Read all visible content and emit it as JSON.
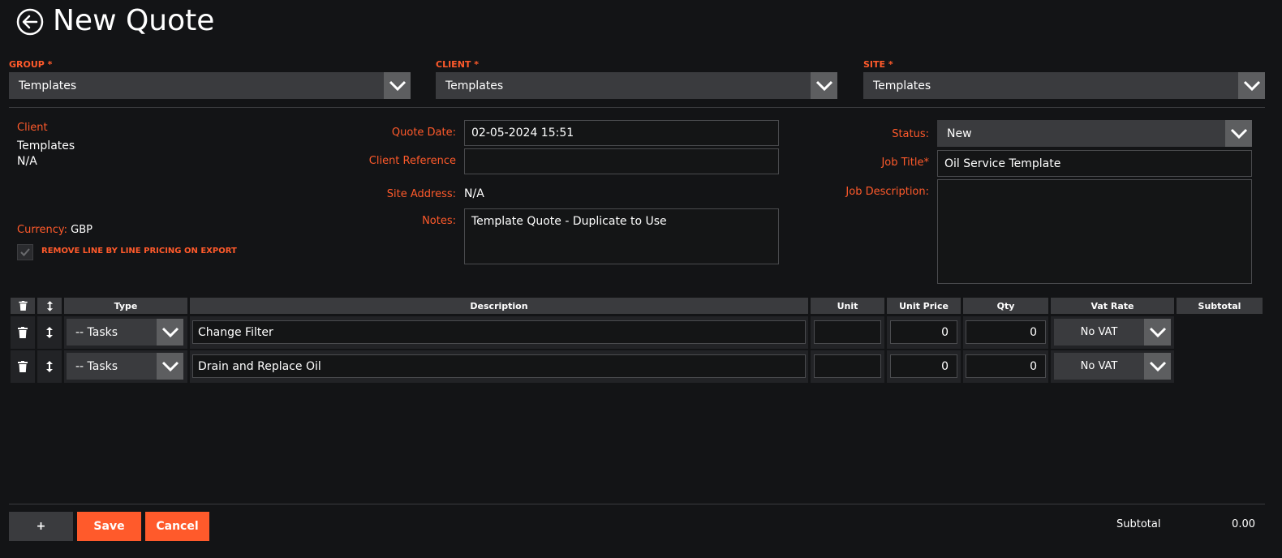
{
  "header": {
    "title": "New Quote"
  },
  "top": {
    "group": {
      "label": "GROUP *",
      "value": "Templates"
    },
    "client": {
      "label": "CLIENT *",
      "value": "Templates"
    },
    "site": {
      "label": "SITE *",
      "value": "Templates"
    }
  },
  "left": {
    "client_label": "Client",
    "client_name": "Templates",
    "client_ref": "N/A",
    "currency_label": "Currency:",
    "currency_value": "GBP",
    "remove_pricing_label": "REMOVE LINE BY LINE PRICING ON EXPORT"
  },
  "middle": {
    "quote_date_label": "Quote Date:",
    "quote_date_value": "02-05-2024 15:51",
    "client_reference_label": "Client Reference",
    "client_reference_value": "",
    "site_address_label": "Site Address:",
    "site_address_value": "N/A",
    "notes_label": "Notes:",
    "notes_value": "Template Quote - Duplicate to Use"
  },
  "right": {
    "status_label": "Status:",
    "status_value": "New",
    "job_title_label": "Job Title*",
    "job_title_value": "Oil Service Template",
    "job_description_label": "Job Description:",
    "job_description_value": ""
  },
  "table": {
    "headers": {
      "type": "Type",
      "description": "Description",
      "unit": "Unit",
      "unit_price": "Unit Price",
      "qty": "Qty",
      "vat_rate": "Vat Rate",
      "subtotal": "Subtotal"
    },
    "rows": [
      {
        "type": "-- Tasks",
        "description": "Change Filter",
        "unit": "",
        "unit_price": "0",
        "qty": "0",
        "vat": "No VAT"
      },
      {
        "type": "-- Tasks",
        "description": "Drain and Replace Oil",
        "unit": "",
        "unit_price": "0",
        "qty": "0",
        "vat": "No VAT"
      }
    ]
  },
  "footer": {
    "add_label": "+",
    "save_label": "Save",
    "cancel_label": "Cancel",
    "subtotal_label": "Subtotal",
    "subtotal_value": "0.00"
  },
  "colors": {
    "accent": "#ff5a2b",
    "background": "#131416",
    "control": "#3a3b3e"
  },
  "icons": [
    "back-arrow-icon",
    "chevron-down-icon",
    "trash-icon",
    "sort-arrows-icon",
    "check-icon"
  ]
}
